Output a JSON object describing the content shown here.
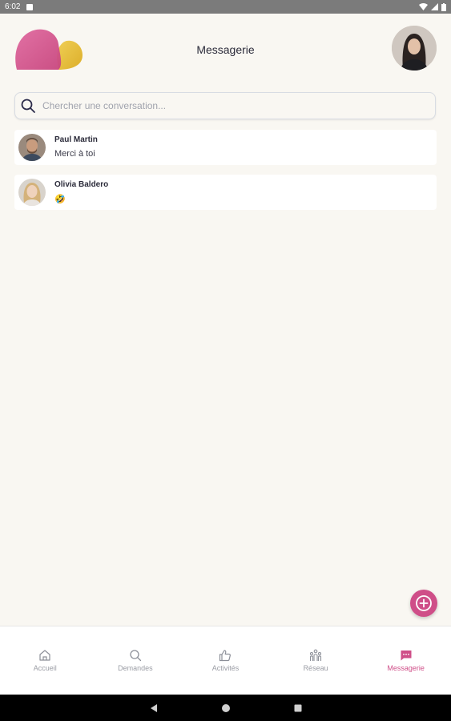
{
  "status_bar": {
    "time": "6:02"
  },
  "header": {
    "title": "Messagerie"
  },
  "search": {
    "placeholder": "Chercher une conversation..."
  },
  "conversations": [
    {
      "name": "Paul Martin",
      "last_message": "Merci à toi"
    },
    {
      "name": "Olivia Baldero",
      "last_message": "🤣"
    }
  ],
  "bottom_nav": [
    {
      "label": "Accueil",
      "icon": "home-icon",
      "active": false
    },
    {
      "label": "Demandes",
      "icon": "search-icon",
      "active": false
    },
    {
      "label": "Activités",
      "icon": "thumbs-up-icon",
      "active": false
    },
    {
      "label": "Réseau",
      "icon": "network-icon",
      "active": false
    },
    {
      "label": "Messagerie",
      "icon": "chat-icon",
      "active": true
    }
  ],
  "colors": {
    "accent": "#cf4e88",
    "background": "#f9f7f2",
    "logo_pink": "#d9508b",
    "logo_yellow": "#e9c13a"
  }
}
